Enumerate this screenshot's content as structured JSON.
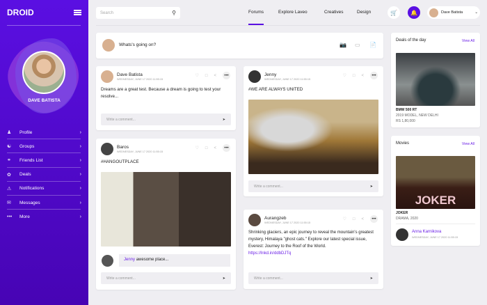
{
  "app": {
    "logo": "DROID"
  },
  "sidebar": {
    "user_name": "DAVE BATISTA",
    "items": [
      {
        "label": "Profile",
        "icon": "user-icon"
      },
      {
        "label": "Groups",
        "icon": "groups-icon"
      },
      {
        "label": "Friends List",
        "icon": "handshake-icon"
      },
      {
        "label": "Deals",
        "icon": "deals-icon"
      },
      {
        "label": "Notifications",
        "icon": "bell-icon"
      },
      {
        "label": "Messages",
        "icon": "envelope-icon"
      },
      {
        "label": "More",
        "icon": "dots-icon"
      }
    ]
  },
  "header": {
    "search_placeholder": "Search",
    "nav": [
      "Forums",
      "Explore Laveo",
      "Creatives",
      "Design"
    ],
    "active_nav": "Forums",
    "user": "Dave Batista"
  },
  "composer": {
    "placeholder": "Whats's going on?"
  },
  "comment_placeholder": "Write a comment...",
  "posts": [
    {
      "author": "Dave Batista",
      "date": "WEDNESDAY, JUNE 17 2020 11:55:15",
      "text": "Dreams are a great test. Because a dream is going to test your resolve..."
    },
    {
      "author": "Baros",
      "date": "WEDNESDAY, JUNE 17 2020 11:55:15",
      "text": "#HANGOUTPLACE",
      "reply_author": "Jenny",
      "reply_text": "awesome place..."
    },
    {
      "author": "Jenny",
      "date": "WEDNESDAY, JUNE 17 2020 11:55:15",
      "text": "#WE ARE ALWAYS UNITED"
    },
    {
      "author": "Aurangzeb",
      "date": "WEDNESDAY, JUNE 17 2020 11:55:15",
      "text": "Shrinking glaciers, an epic journey to reveal the mountain's greatest mystery, Himalaya \"ghost cats.\" Explore our latest special issue, Everest: Journey to the Roof of the World.",
      "link": "https://lnkd.in/ddbDJTq"
    }
  ],
  "deals": {
    "title": "Deals of the day",
    "view_all": "View All",
    "item": "BMW 500 RT",
    "desc": "2019 MODEL, NEW DELHI",
    "price": "RS 1,80,000"
  },
  "movies": {
    "title": "Movies",
    "view_all": "View All",
    "poster_text": "JOKER",
    "item": "JOKER",
    "desc": "DRAMA, 2020",
    "user": "Anna Karnikova",
    "date": "WEDNESDAY, JUNE 17 2020 11:55:15"
  },
  "colors": {
    "accent": "#5a0fe2",
    "background": "#efeef2"
  }
}
